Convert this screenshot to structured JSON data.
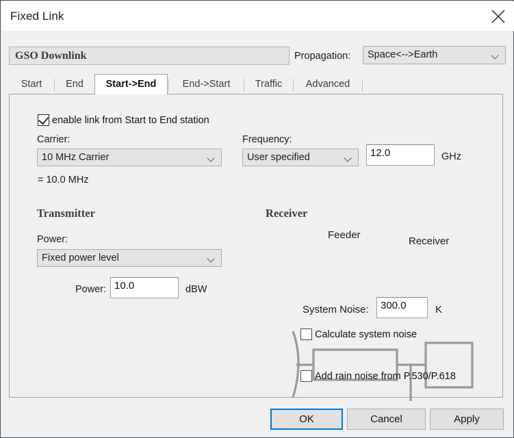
{
  "window": {
    "title": "Fixed Link",
    "close_icon": "close-icon"
  },
  "header": {
    "name_value": "GSO Downlink",
    "propagation_label": "Propagation:",
    "propagation_value": "Space<-->Earth"
  },
  "tabs": [
    {
      "label": "Start",
      "active": false
    },
    {
      "label": "End",
      "active": false
    },
    {
      "label": "Start->End",
      "active": true
    },
    {
      "label": "End->Start",
      "active": false
    },
    {
      "label": "Traffic",
      "active": false
    },
    {
      "label": "Advanced",
      "active": false
    }
  ],
  "panel": {
    "enable_link": {
      "label": "enable link from Start to End station",
      "checked": true
    },
    "carrier": {
      "label": "Carrier:",
      "value": "10 MHz Carrier",
      "note": "=  10.0 MHz"
    },
    "frequency": {
      "label": "Frequency:",
      "mode_value": "User specified",
      "value": "12.0",
      "unit": "GHz"
    },
    "transmitter": {
      "heading": "Transmitter",
      "power_label": "Power:",
      "power_mode_value": "Fixed power level",
      "power_value_label": "Power:",
      "power_value": "10.0",
      "power_unit": "dBW"
    },
    "receiver": {
      "heading": "Receiver",
      "diagram": {
        "antenna_label": "antenna-icon",
        "feeder_label": "Feeder",
        "receiver_label": "Receiver"
      },
      "system_noise_label": "System Noise:",
      "system_noise_value": "300.0",
      "system_noise_unit": "K",
      "calculate_system_noise": {
        "label": "Calculate system noise",
        "checked": false
      },
      "add_rain_noise": {
        "label": "Add rain noise from P.530/P.618",
        "checked": false
      }
    }
  },
  "footer": {
    "ok_label": "OK",
    "cancel_label": "Cancel",
    "apply_label": "Apply"
  },
  "colors": {
    "accent": "#0078d7",
    "panel_bg": "#f0f0f0",
    "field_bg": "#e4e4e4",
    "diagram_stroke": "#9a9a9a"
  }
}
